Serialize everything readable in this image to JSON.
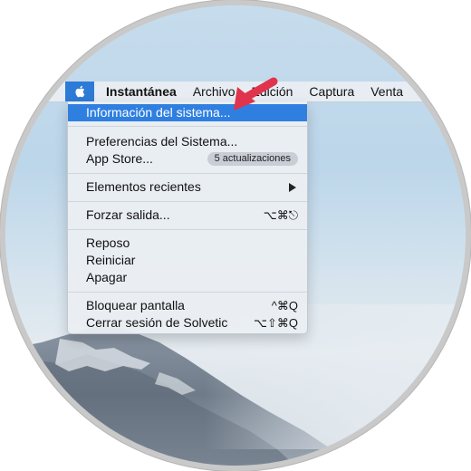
{
  "menubar": {
    "apple_icon": "apple-logo-icon",
    "items": [
      "Instantánea",
      "Archivo",
      "Edición",
      "Captura",
      "Venta"
    ]
  },
  "menu": {
    "system_info": "Información del sistema...",
    "preferences": "Preferencias del Sistema...",
    "app_store": "App Store...",
    "app_store_badge": "5 actualizaciones",
    "recent_items": "Elementos recientes",
    "force_quit": "Forzar salida...",
    "force_quit_shortcut": "⌥⌘⎋",
    "sleep": "Reposo",
    "restart": "Reiniciar",
    "shutdown": "Apagar",
    "lock_screen": "Bloquear pantalla",
    "lock_screen_shortcut": "^⌘Q",
    "logout": "Cerrar sesión de Solvetic",
    "logout_shortcut": "⌥⇧⌘Q"
  },
  "colors": {
    "highlight": "#2f7fe0",
    "callout_arrow": "#e0334c"
  }
}
